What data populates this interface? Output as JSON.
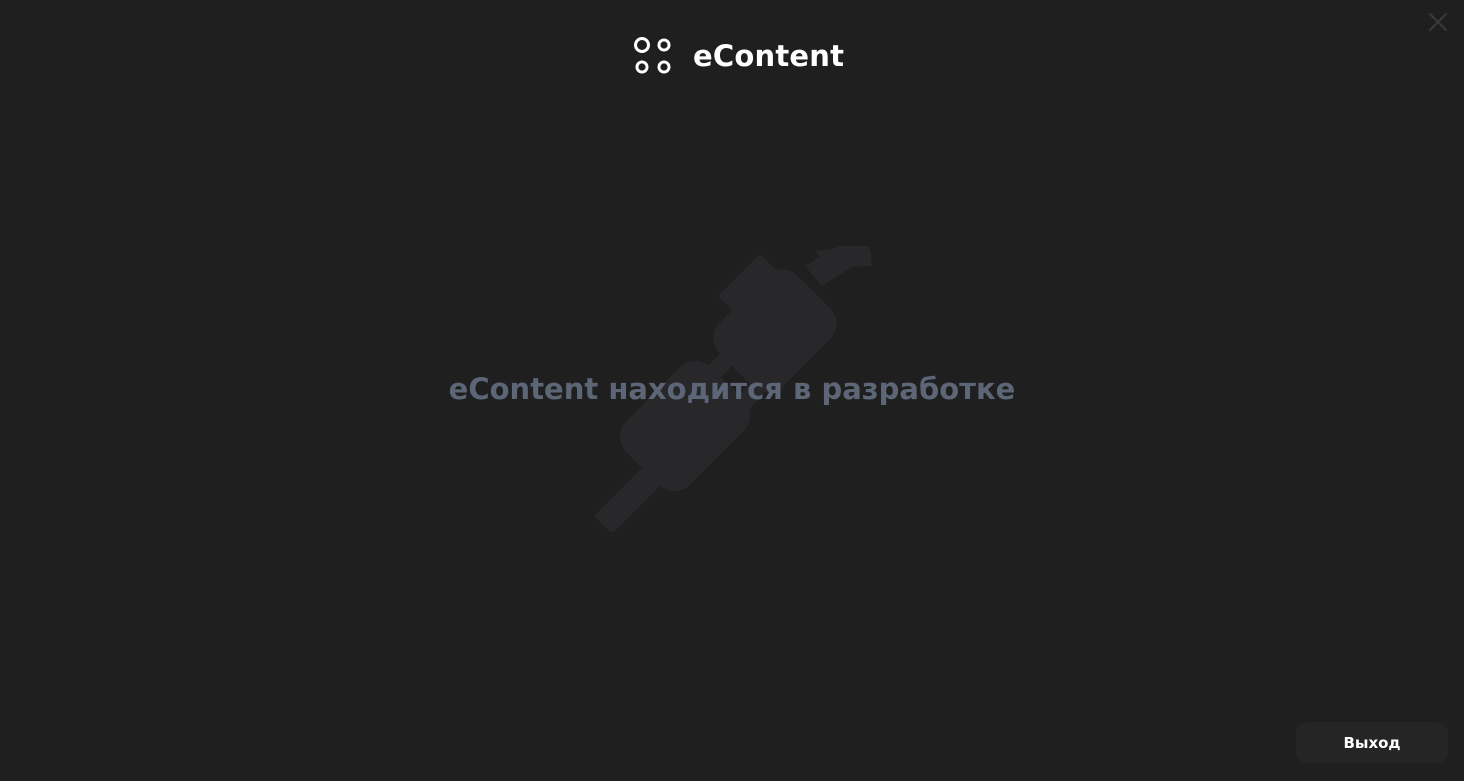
{
  "app": {
    "brand_name": "eContent"
  },
  "main": {
    "message": "eContent находится в разработке",
    "illustration": "unplugged-plug-icon"
  },
  "footer": {
    "exit_label": "Выход"
  },
  "window": {
    "close_icon": "close-icon"
  },
  "colors": {
    "background": "#1f1f1f",
    "brand_text": "#ffffff",
    "message_text": "#5d6677",
    "illustration": "#28282b",
    "exit_button_bg": "#252525",
    "close_icon": "#3a3a3a"
  }
}
